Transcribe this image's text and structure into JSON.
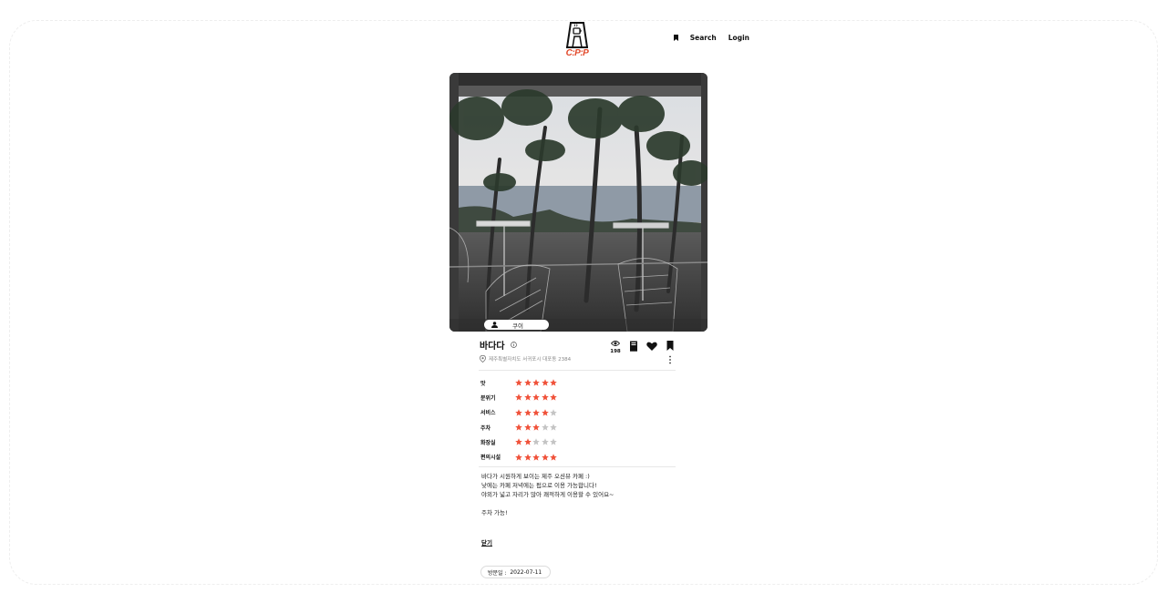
{
  "header": {
    "logo_text": "C:P:P",
    "nav": {
      "search_label": "Search",
      "login_label": "Login"
    }
  },
  "post": {
    "author": "쿠이",
    "cafe_name": "바다다",
    "address": "제주특별자치도 서귀포시 대포동 2384",
    "views": "198",
    "ratings": [
      {
        "label": "맛",
        "score": 5
      },
      {
        "label": "분위기",
        "score": 5
      },
      {
        "label": "서비스",
        "score": 4
      },
      {
        "label": "주차",
        "score": 3
      },
      {
        "label": "화장실",
        "score": 2
      },
      {
        "label": "편의시설",
        "score": 5
      }
    ],
    "max_score": 5,
    "review_lines": [
      "바다가 시원하게 보이는 제주 오션뷰 카페 :)",
      "낮에는 카페 저녁에는 펍으로 이용 가능합니다!",
      "야외가 넓고 자리가 많아 쾌적하게 이용할 수 있어요~",
      "",
      "주차 가능!"
    ],
    "close_label": "닫기",
    "visit_label": "방문일 :",
    "visit_date": "2022-07-11"
  },
  "colors": {
    "accent": "#e24a2c",
    "star_on": "#f0523a",
    "star_off": "#c4c4c4"
  },
  "icons": [
    "bookmark-icon",
    "person-icon",
    "info-icon",
    "pin-icon",
    "eye-icon",
    "menu-book-icon",
    "heart-icon",
    "more-icon",
    "star-icon"
  ]
}
